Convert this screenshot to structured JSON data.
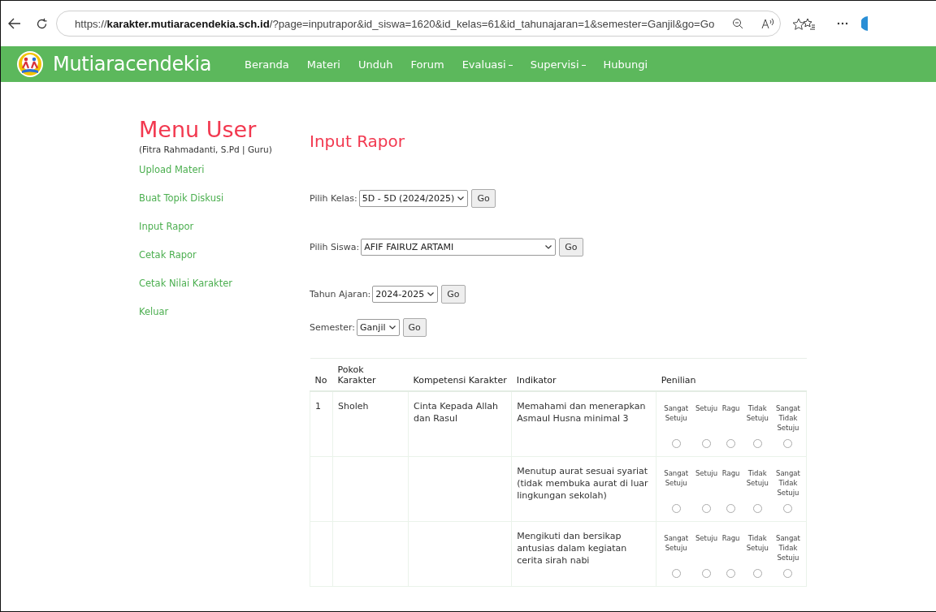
{
  "browser": {
    "url": "https://**karakter.mutiaracendekia.sch.id**/?page=inputrapor&id_siswa=1620&id_kelas=61&id_tahunajaran=1&semester=Ganjil&go=Go"
  },
  "navbar": {
    "brand": "Mutiaracendekia",
    "items": [
      {
        "label": "Beranda",
        "dropdown": false
      },
      {
        "label": "Materi",
        "dropdown": false
      },
      {
        "label": "Unduh",
        "dropdown": false
      },
      {
        "label": "Forum",
        "dropdown": false
      },
      {
        "label": "Evaluasi",
        "dropdown": true
      },
      {
        "label": "Supervisi",
        "dropdown": true
      },
      {
        "label": "Hubungi",
        "dropdown": false
      }
    ]
  },
  "sidebar": {
    "title": "Menu User",
    "user": "(Fitra Rahmadanti, S.Pd | Guru)",
    "items": [
      "Upload Materi",
      "Buat Topik Diskusi",
      "Input Rapor",
      "Cetak Rapor",
      "Cetak Nilai Karakter",
      "Keluar"
    ]
  },
  "main": {
    "title": "Input Rapor",
    "filters": [
      {
        "label": "Pilih Kelas:",
        "value": "5D - 5D (2024/2025)",
        "button": "Go",
        "wide": false
      },
      {
        "label": "Pilih Siswa:",
        "value": "AFIF FAIRUZ ARTAMI",
        "button": "Go",
        "wide": true
      },
      {
        "label": "Tahun Ajaran:",
        "value": "2024-2025",
        "button": "Go",
        "wide": false
      },
      {
        "label": "Semester:",
        "value": "Ganjil",
        "button": "Go",
        "wide": false
      }
    ]
  },
  "table": {
    "columns": [
      "No",
      "Pokok Karakter",
      "Kompetensi Karakter",
      "Indikator",
      "Penilian"
    ],
    "rows": [
      {
        "no": "1",
        "pokok": "Sholeh",
        "kompetensi": "Cinta Kepada Allah dan Rasul",
        "indikator": "Memahami dan menerapkan Asmaul Husna minimal 3",
        "options": [
          {
            "label": "Sangat Setuju",
            "selected": false
          },
          {
            "label": "Setuju",
            "selected": false
          },
          {
            "label": "Ragu",
            "selected": false
          },
          {
            "label": "Tidak Setuju",
            "selected": false
          },
          {
            "label": "Sangat Tidak Setuju",
            "selected": false
          }
        ]
      },
      {
        "no": "",
        "pokok": "",
        "kompetensi": "",
        "indikator": "Menutup aurat sesuai syariat (tidak membuka aurat di luar lingkungan sekolah)",
        "options": [
          {
            "label": "Sangat Setuju",
            "selected": false
          },
          {
            "label": "Setuju",
            "selected": false
          },
          {
            "label": "Ragu",
            "selected": false
          },
          {
            "label": "Tidak Setuju",
            "selected": false
          },
          {
            "label": "Sangat Tidak Setuju",
            "selected": false
          }
        ]
      },
      {
        "no": "",
        "pokok": "",
        "kompetensi": "",
        "indikator": "Mengikuti dan bersikap antusias dalam kegiatan cerita sirah nabi",
        "options": [
          {
            "label": "Sangat Setuju",
            "selected": false
          },
          {
            "label": "Setuju",
            "selected": false
          },
          {
            "label": "Ragu",
            "selected": false
          },
          {
            "label": "Tidak Setuju",
            "selected": false
          },
          {
            "label": "Sangat Tidak Setuju",
            "selected": false
          }
        ]
      }
    ]
  }
}
